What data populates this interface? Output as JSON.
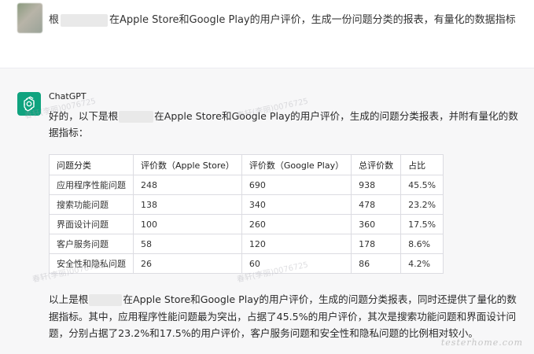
{
  "user": {
    "msg_before": "根",
    "msg_after": "在Apple Store和Google Play的用户评价，生成一份问题分类的报表，有量化的数据指标"
  },
  "assistant": {
    "sender": "ChatGPT",
    "intro_before": "好的，以下是根",
    "intro_after": "在Apple Store和Google Play的用户评价，生成的问题分类报表，并附有量化的数据指标：",
    "table": {
      "headers": [
        "问题分类",
        "评价数（Apple Store）",
        "评价数（Google Play）",
        "总评价数",
        "占比"
      ],
      "rows": [
        [
          "应用程序性能问题",
          "248",
          "690",
          "938",
          "45.5%"
        ],
        [
          "搜索功能问题",
          "138",
          "340",
          "478",
          "23.2%"
        ],
        [
          "界面设计问题",
          "100",
          "260",
          "360",
          "17.5%"
        ],
        [
          "客户服务问题",
          "58",
          "120",
          "178",
          "8.6%"
        ],
        [
          "安全性和隐私问题",
          "26",
          "60",
          "86",
          "4.2%"
        ]
      ]
    },
    "summary_before": "以上是根",
    "summary_after": "在Apple Store和Google Play的用户评价，生成的问题分类报表，同时还提供了量化的数据指标。其中，应用程序性能问题最为突出，占据了45.5%的用户评价，其次是搜索功能问题和界面设计问题，分别占据了23.2%和17.5%的用户评价，客户服务问题和安全性和隐私问题的比例相对较小。"
  },
  "watermarks": [
    "春轩(李丽)0076725",
    "春轩(李丽)0076725",
    "春轩(李丽)0076725",
    "春轩(李丽)0076725"
  ],
  "site_watermark": "testerhome.com",
  "colors": {
    "brand_green": "#10a37f",
    "assistant_bg": "#f7f7f8"
  }
}
